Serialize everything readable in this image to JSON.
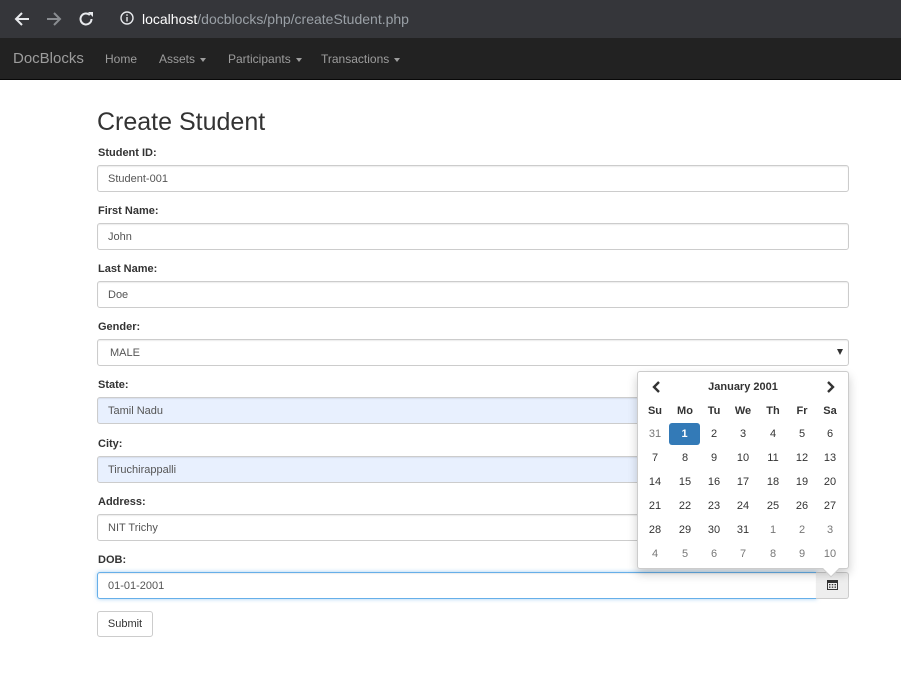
{
  "browser": {
    "url_host": "localhost",
    "url_path": "/docblocks/php/createStudent.php"
  },
  "navbar": {
    "brand": "DocBlocks",
    "items": [
      "Home",
      "Assets",
      "Participants",
      "Transactions"
    ]
  },
  "form": {
    "title": "Create Student",
    "student_id_label": "Student ID:",
    "student_id_value": "Student-001",
    "first_name_label": "First Name:",
    "first_name_value": "John",
    "last_name_label": "Last Name:",
    "last_name_value": "Doe",
    "gender_label": "Gender:",
    "gender_value": "MALE",
    "state_label": "State:",
    "state_value": "Tamil Nadu",
    "city_label": "City:",
    "city_value": "Tiruchirappalli",
    "address_label": "Address:",
    "address_value": "NIT Trichy",
    "dob_label": "DOB:",
    "dob_value": "01-01-2001",
    "submit_label": "Submit"
  },
  "datepicker": {
    "month_year": "January 2001",
    "dow": [
      "Su",
      "Mo",
      "Tu",
      "We",
      "Th",
      "Fr",
      "Sa"
    ],
    "weeks": [
      [
        "31",
        "1",
        "2",
        "3",
        "4",
        "5",
        "6"
      ],
      [
        "7",
        "8",
        "9",
        "10",
        "11",
        "12",
        "13"
      ],
      [
        "14",
        "15",
        "16",
        "17",
        "18",
        "19",
        "20"
      ],
      [
        "21",
        "22",
        "23",
        "24",
        "25",
        "26",
        "27"
      ],
      [
        "28",
        "29",
        "30",
        "31",
        "1",
        "2",
        "3"
      ],
      [
        "4",
        "5",
        "6",
        "7",
        "8",
        "9",
        "10"
      ]
    ],
    "selected": "1"
  }
}
